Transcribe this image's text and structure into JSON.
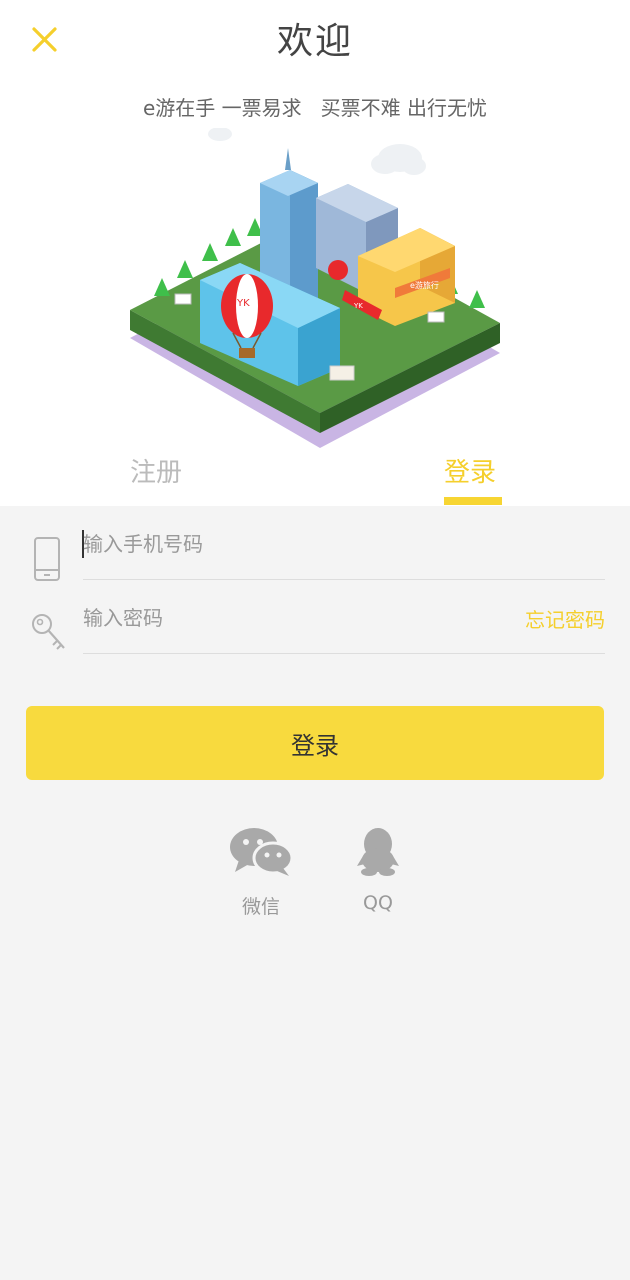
{
  "header": {
    "title": "欢迎",
    "slogan": "e游在手 一票易求   买票不难 出行无忧",
    "close_icon": "close-icon"
  },
  "illustration": {
    "balloon_text": "YK",
    "banner_text": "YK",
    "store_sign": "e游旅行"
  },
  "tabs": {
    "register": "注册",
    "login": "登录",
    "active": "login"
  },
  "form": {
    "phone": {
      "placeholder": "输入手机号码",
      "value": "",
      "icon": "phone-icon"
    },
    "password": {
      "placeholder": "输入密码",
      "value": "",
      "icon": "key-icon"
    },
    "forgot_label": "忘记密码",
    "submit_label": "登录"
  },
  "social": {
    "wechat": {
      "label": "微信",
      "icon": "wechat-icon"
    },
    "qq": {
      "label": "QQ",
      "icon": "qq-icon"
    }
  },
  "colors": {
    "accent": "#f8da3e",
    "accent_text": "#f5cf2c",
    "background": "#f4f4f4"
  }
}
